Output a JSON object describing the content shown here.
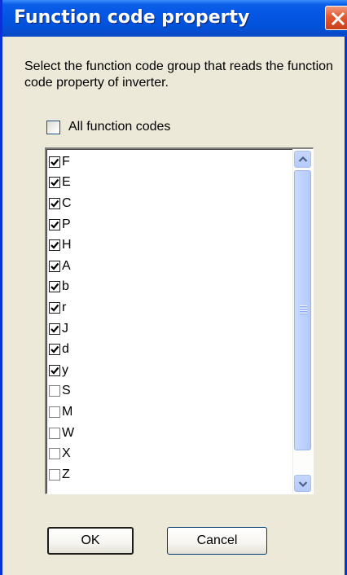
{
  "window": {
    "title": "Function code property"
  },
  "dialog": {
    "prompt": "Select the function code group that reads the function code property of inverter.",
    "all_checkbox": {
      "label": "All function codes",
      "checked": false
    }
  },
  "list": {
    "items": [
      {
        "label": "F",
        "checked": true
      },
      {
        "label": "E",
        "checked": true
      },
      {
        "label": "C",
        "checked": true
      },
      {
        "label": "P",
        "checked": true
      },
      {
        "label": "H",
        "checked": true
      },
      {
        "label": "A",
        "checked": true
      },
      {
        "label": "b",
        "checked": true
      },
      {
        "label": "r",
        "checked": true
      },
      {
        "label": "J",
        "checked": true
      },
      {
        "label": "d",
        "checked": true
      },
      {
        "label": "y",
        "checked": true
      },
      {
        "label": "S",
        "checked": false
      },
      {
        "label": "M",
        "checked": false
      },
      {
        "label": "W",
        "checked": false
      },
      {
        "label": "X",
        "checked": false
      },
      {
        "label": "Z",
        "checked": false
      }
    ]
  },
  "buttons": {
    "ok_label": "OK",
    "cancel_label": "Cancel"
  },
  "icons": {
    "close": "close-icon",
    "scroll_up": "chevron-up-icon",
    "scroll_down": "chevron-down-icon",
    "check": "checkmark-icon"
  },
  "colors": {
    "titlebar": "#0556e3",
    "close_button": "#e2582f",
    "face": "#ece9d8"
  }
}
